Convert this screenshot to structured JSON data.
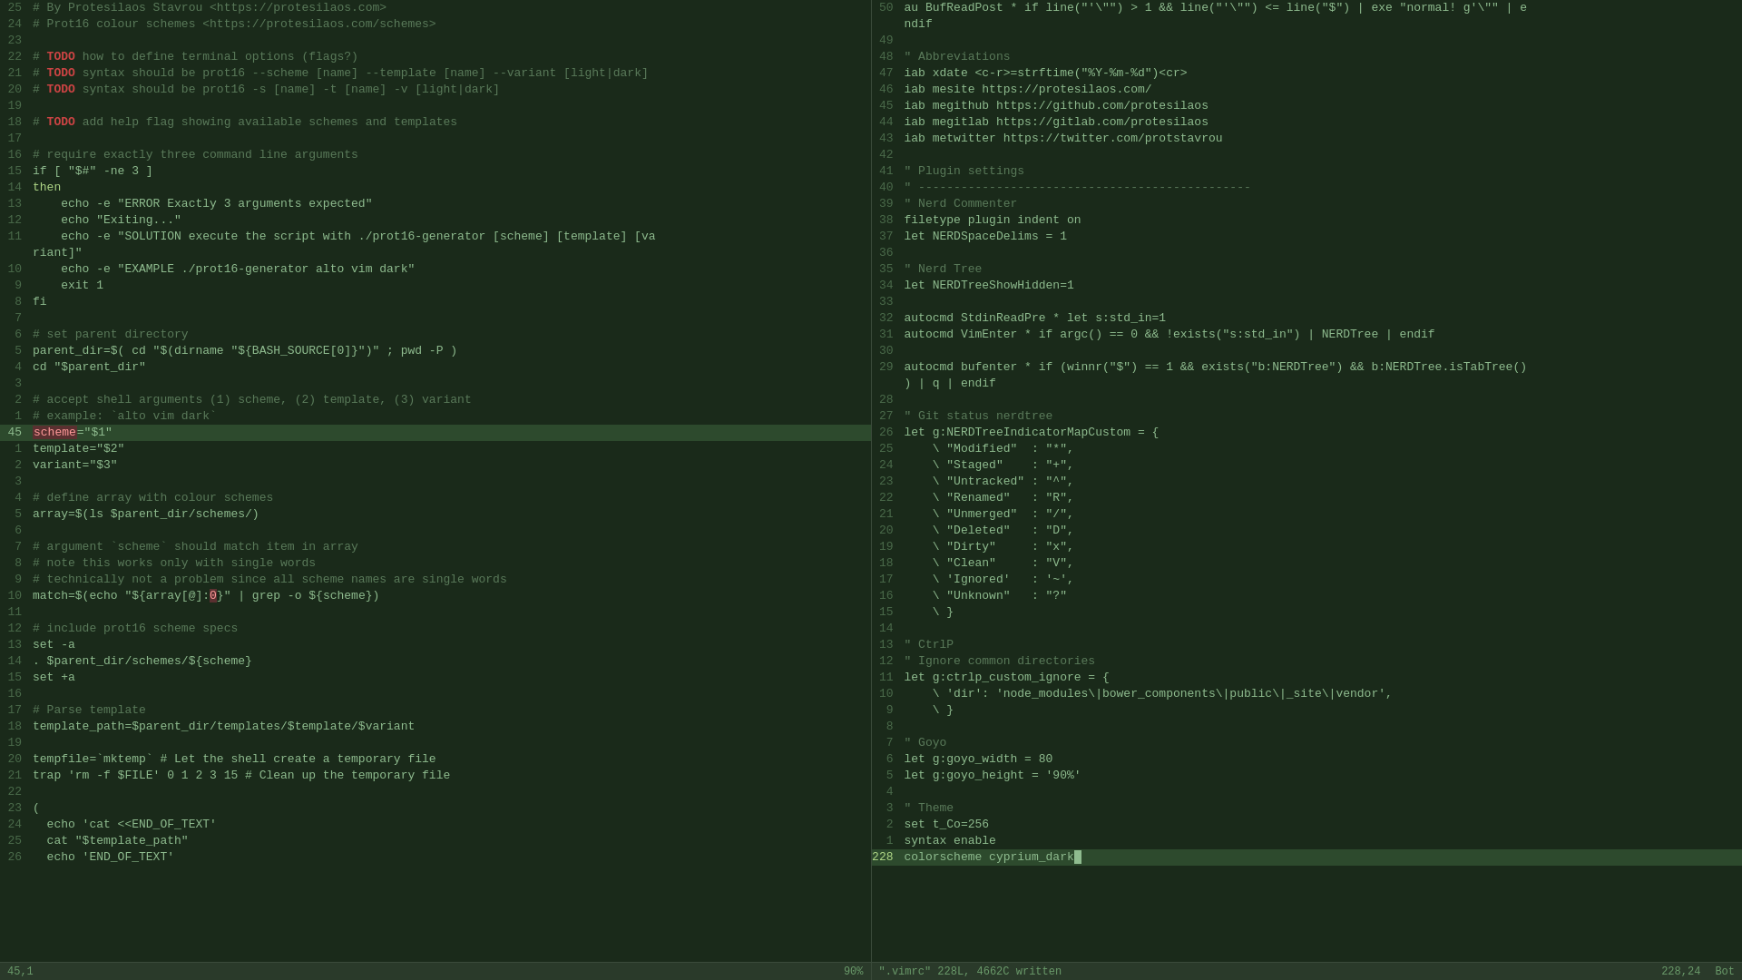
{
  "left_pane": {
    "lines": [
      {
        "num": "25",
        "content": "# By Protesilaos Stavrou <https://protesilaos.com>",
        "type": "comment"
      },
      {
        "num": "24",
        "content": "# Prot16 colour schemes <https://protesilaos.com/schemes>",
        "type": "comment"
      },
      {
        "num": "23",
        "content": "",
        "type": "normal"
      },
      {
        "num": "22",
        "content": "# TODO how to define terminal options (flags?)",
        "type": "comment-todo"
      },
      {
        "num": "21",
        "content": "# TODO syntax should be prot16 --scheme [name] --template [name] --variant [light|dark]",
        "type": "comment-todo"
      },
      {
        "num": "20",
        "content": "# TODO syntax should be prot16 -s [name] -t [name] -v [light|dark]",
        "type": "comment-todo"
      },
      {
        "num": "19",
        "content": "",
        "type": "normal"
      },
      {
        "num": "18",
        "content": "# TODO add help flag showing available schemes and templates",
        "type": "comment-todo"
      },
      {
        "num": "17",
        "content": "",
        "type": "normal"
      },
      {
        "num": "16",
        "content": "# require exactly three command line arguments",
        "type": "comment"
      },
      {
        "num": "15",
        "content": "if [ \"$#\" -ne 3 ]",
        "type": "normal"
      },
      {
        "num": "14",
        "content": "then",
        "type": "keyword"
      },
      {
        "num": "13",
        "content": "    echo -e \"ERROR Exactly 3 arguments expected\"",
        "type": "normal"
      },
      {
        "num": "12",
        "content": "    echo \"Exiting...\"",
        "type": "normal"
      },
      {
        "num": "11",
        "content": "    echo -e \"SOLUTION execute the script with ./prot16-generator [scheme] [template] [va",
        "type": "normal"
      },
      {
        "num": "",
        "content": "riant]\"",
        "type": "normal"
      },
      {
        "num": "10",
        "content": "    echo -e \"EXAMPLE ./prot16-generator alto vim dark\"",
        "type": "normal"
      },
      {
        "num": "9",
        "content": "    exit 1",
        "type": "normal"
      },
      {
        "num": "8",
        "content": "fi",
        "type": "normal"
      },
      {
        "num": "7",
        "content": "",
        "type": "normal"
      },
      {
        "num": "6",
        "content": "# set parent directory",
        "type": "comment"
      },
      {
        "num": "5",
        "content": "parent_dir=$( cd \"$(dirname \"${BASH_SOURCE[0]}\")\" ; pwd -P )",
        "type": "normal"
      },
      {
        "num": "4",
        "content": "cd \"$parent_dir\"",
        "type": "normal"
      },
      {
        "num": "3",
        "content": "",
        "type": "normal"
      },
      {
        "num": "2",
        "content": "# accept shell arguments (1) scheme, (2) template, (3) variant",
        "type": "comment"
      },
      {
        "num": "1",
        "content": "# example: `alto vim dark`",
        "type": "comment"
      },
      {
        "num": "45",
        "content": "scheme=\"$1\"",
        "type": "highlight-line"
      },
      {
        "num": "1",
        "content": "template=\"$2\"",
        "type": "normal"
      },
      {
        "num": "2",
        "content": "variant=\"$3\"",
        "type": "normal"
      },
      {
        "num": "3",
        "content": "",
        "type": "normal"
      },
      {
        "num": "4",
        "content": "# define array with colour schemes",
        "type": "comment"
      },
      {
        "num": "5",
        "content": "array=$(ls $parent_dir/schemes/)",
        "type": "normal"
      },
      {
        "num": "6",
        "content": "",
        "type": "normal"
      },
      {
        "num": "7",
        "content": "# argument `scheme` should match item in array",
        "type": "comment"
      },
      {
        "num": "8",
        "content": "# note this works only with single words",
        "type": "comment"
      },
      {
        "num": "9",
        "content": "# technically not a problem since all scheme names are single words",
        "type": "comment"
      },
      {
        "num": "10",
        "content": "match=$(echo \"${array[@]:0}\" | grep -o ${scheme})",
        "type": "normal-special"
      },
      {
        "num": "11",
        "content": "",
        "type": "normal"
      },
      {
        "num": "12",
        "content": "# include prot16 scheme specs",
        "type": "comment"
      },
      {
        "num": "13",
        "content": "set -a",
        "type": "normal"
      },
      {
        "num": "14",
        "content": ". $parent_dir/schemes/${scheme}",
        "type": "normal"
      },
      {
        "num": "15",
        "content": "set +a",
        "type": "normal"
      },
      {
        "num": "16",
        "content": "",
        "type": "normal"
      },
      {
        "num": "17",
        "content": "# Parse template",
        "type": "comment"
      },
      {
        "num": "18",
        "content": "template_path=$parent_dir/templates/$template/$variant",
        "type": "normal"
      },
      {
        "num": "19",
        "content": "",
        "type": "normal"
      },
      {
        "num": "20",
        "content": "tempfile=`mktemp` # Let the shell create a temporary file",
        "type": "normal"
      },
      {
        "num": "21",
        "content": "trap 'rm -f $FILE' 0 1 2 3 15 # Clean up the temporary file",
        "type": "normal"
      },
      {
        "num": "22",
        "content": "",
        "type": "normal"
      },
      {
        "num": "23",
        "content": "(",
        "type": "normal"
      },
      {
        "num": "24",
        "content": "  echo 'cat <<END_OF_TEXT'",
        "type": "normal"
      },
      {
        "num": "25",
        "content": "  cat \"$template_path\"",
        "type": "normal"
      },
      {
        "num": "26",
        "content": "  echo 'END_OF_TEXT'",
        "type": "normal"
      }
    ],
    "status": {
      "position": "45,1",
      "percent": "90%"
    }
  },
  "right_pane": {
    "lines": [
      {
        "num": "50",
        "content": "au BufReadPost * if line(\"'\\\"'\") > 1 && line(\"'\\\"'\") <= line(\"$\") | exe \"normal! g'\\\"\" | e"
      },
      {
        "num": "",
        "content": "ndif"
      },
      {
        "num": "49",
        "content": ""
      },
      {
        "num": "48",
        "content": "\" Abbreviations"
      },
      {
        "num": "47",
        "content": "iab xdate <c-r>=strftime(\"%Y-%m-%d\")<cr>"
      },
      {
        "num": "46",
        "content": "iab mesite https://protesilaos.com/"
      },
      {
        "num": "45",
        "content": "iab megithub https://github.com/protesilaos"
      },
      {
        "num": "44",
        "content": "iab megitlab https://gitlab.com/protesilaos"
      },
      {
        "num": "43",
        "content": "iab metwitter https://twitter.com/protstavrou"
      },
      {
        "num": "42",
        "content": ""
      },
      {
        "num": "41",
        "content": "\" Plugin settings"
      },
      {
        "num": "40",
        "content": "\" -----------------------------------------------"
      },
      {
        "num": "39",
        "content": "\" Nerd Commenter"
      },
      {
        "num": "38",
        "content": "filetype plugin indent on"
      },
      {
        "num": "37",
        "content": "let NERDSpaceDelims = 1"
      },
      {
        "num": "36",
        "content": ""
      },
      {
        "num": "35",
        "content": "\" Nerd Tree"
      },
      {
        "num": "34",
        "content": "let NERDTreeShowHidden=1"
      },
      {
        "num": "33",
        "content": ""
      },
      {
        "num": "32",
        "content": "autocmd StdinReadPre * let s:std_in=1"
      },
      {
        "num": "31",
        "content": "autocmd VimEnter * if argc() == 0 && !exists(\"s:std_in\") | NERDTree | endif"
      },
      {
        "num": "30",
        "content": ""
      },
      {
        "num": "29",
        "content": "autocmd bufenter * if (winnr(\"$\") == 1 && exists(\"b:NERDTree\") && b:NERDTree.isTabTree()"
      },
      {
        "num": "",
        "content": ") | q | endif"
      },
      {
        "num": "28",
        "content": ""
      },
      {
        "num": "27",
        "content": "\" Git status nerdtree"
      },
      {
        "num": "26",
        "content": "let g:NERDTreeIndicatorMapCustom = {"
      },
      {
        "num": "25",
        "content": "    \\ \"Modified\"  : \"*\","
      },
      {
        "num": "24",
        "content": "    \\ \"Staged\"    : \"+\","
      },
      {
        "num": "23",
        "content": "    \\ \"Untracked\" : \"^\","
      },
      {
        "num": "22",
        "content": "    \\ \"Renamed\"   : \"R\","
      },
      {
        "num": "21",
        "content": "    \\ \"Unmerged\"  : \"/\","
      },
      {
        "num": "20",
        "content": "    \\ \"Deleted\"   : \"D\","
      },
      {
        "num": "19",
        "content": "    \\ \"Dirty\"     : \"x\","
      },
      {
        "num": "18",
        "content": "    \\ \"Clean\"     : \"V\","
      },
      {
        "num": "17",
        "content": "    \\ 'Ignored'   : '~',"
      },
      {
        "num": "16",
        "content": "    \\ \"Unknown\"   : \"?\""
      },
      {
        "num": "15",
        "content": "    \\ }"
      },
      {
        "num": "14",
        "content": ""
      },
      {
        "num": "13",
        "content": "\" CtrlP"
      },
      {
        "num": "12",
        "content": "\" Ignore common directories"
      },
      {
        "num": "11",
        "content": "let g:ctrlp_custom_ignore = {"
      },
      {
        "num": "10",
        "content": "    \\ 'dir': 'node_modules\\|bower_components\\|public\\|_site\\|vendor',"
      },
      {
        "num": "9",
        "content": "    \\ }"
      },
      {
        "num": "8",
        "content": ""
      },
      {
        "num": "7",
        "content": "\" Goyo"
      },
      {
        "num": "6",
        "content": "let g:goyo_width = 80"
      },
      {
        "num": "5",
        "content": "let g:goyo_height = '90%'"
      },
      {
        "num": "4",
        "content": ""
      },
      {
        "num": "3",
        "content": "\" Theme"
      },
      {
        "num": "2",
        "content": "set t_Co=256"
      },
      {
        "num": "1",
        "content": "syntax enable"
      },
      {
        "num": "228",
        "content": "colorscheme cyprium_dark",
        "type": "current"
      }
    ],
    "status": {
      "file": "\".vimrc\" 228L, 4662C written",
      "position": "228,24",
      "mode": "Bot"
    }
  }
}
